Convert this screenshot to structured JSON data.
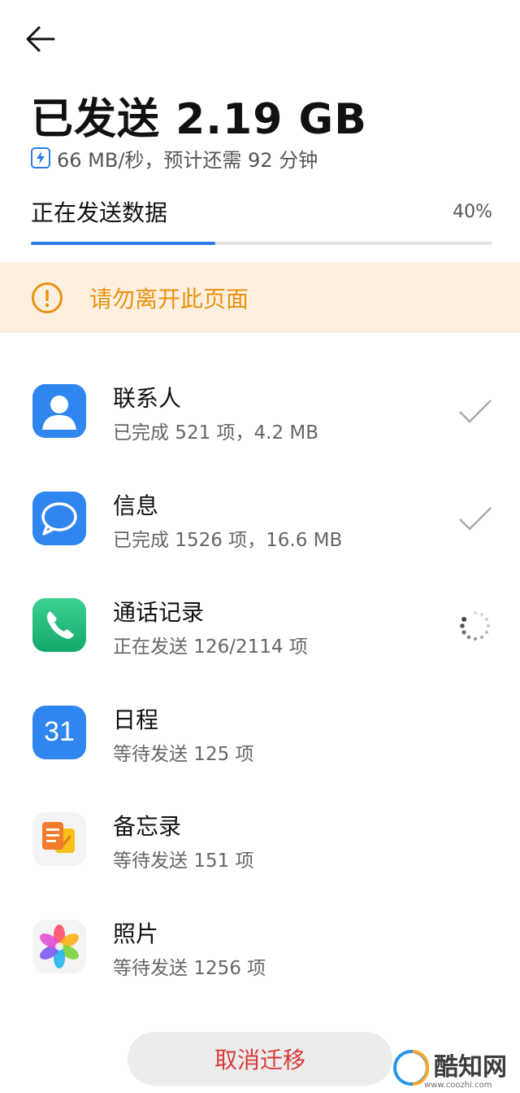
{
  "header": {
    "back_icon": "arrow-left-icon",
    "title": "已发送 2.19 GB",
    "speed_text": "66 MB/秒，预计还需 92 分钟",
    "speed_icon": "lightning-icon"
  },
  "progress": {
    "label": "正在发送数据",
    "percent_text": "40%",
    "fraction": 0.4,
    "color": "#2b7de9"
  },
  "warning": {
    "icon": "exclamation-circle-icon",
    "text": "请勿离开此页面",
    "color": "#e8930f"
  },
  "items": [
    {
      "name": "联系人",
      "sub": "已完成 521 项，4.2 MB",
      "icon": "contacts-icon",
      "status": "done"
    },
    {
      "name": "信息",
      "sub": "已完成 1526 项，16.6 MB",
      "icon": "messages-icon",
      "status": "done"
    },
    {
      "name": "通话记录",
      "sub": "正在发送 126/2114 项",
      "icon": "phone-icon",
      "status": "loading"
    },
    {
      "name": "日程",
      "sub": "等待发送 125 项",
      "icon": "calendar-icon",
      "icon_text": "31",
      "status": "waiting"
    },
    {
      "name": "备忘录",
      "sub": "等待发送 151 项",
      "icon": "notes-icon",
      "status": "waiting"
    },
    {
      "name": "照片",
      "sub": "等待发送 1256 项",
      "icon": "gallery-icon",
      "status": "waiting"
    }
  ],
  "actions": {
    "cancel_label": "取消迁移",
    "cancel_color": "#d93a3a"
  },
  "watermark": {
    "brand": "酷知网",
    "sub": "www.coozhi.com"
  }
}
